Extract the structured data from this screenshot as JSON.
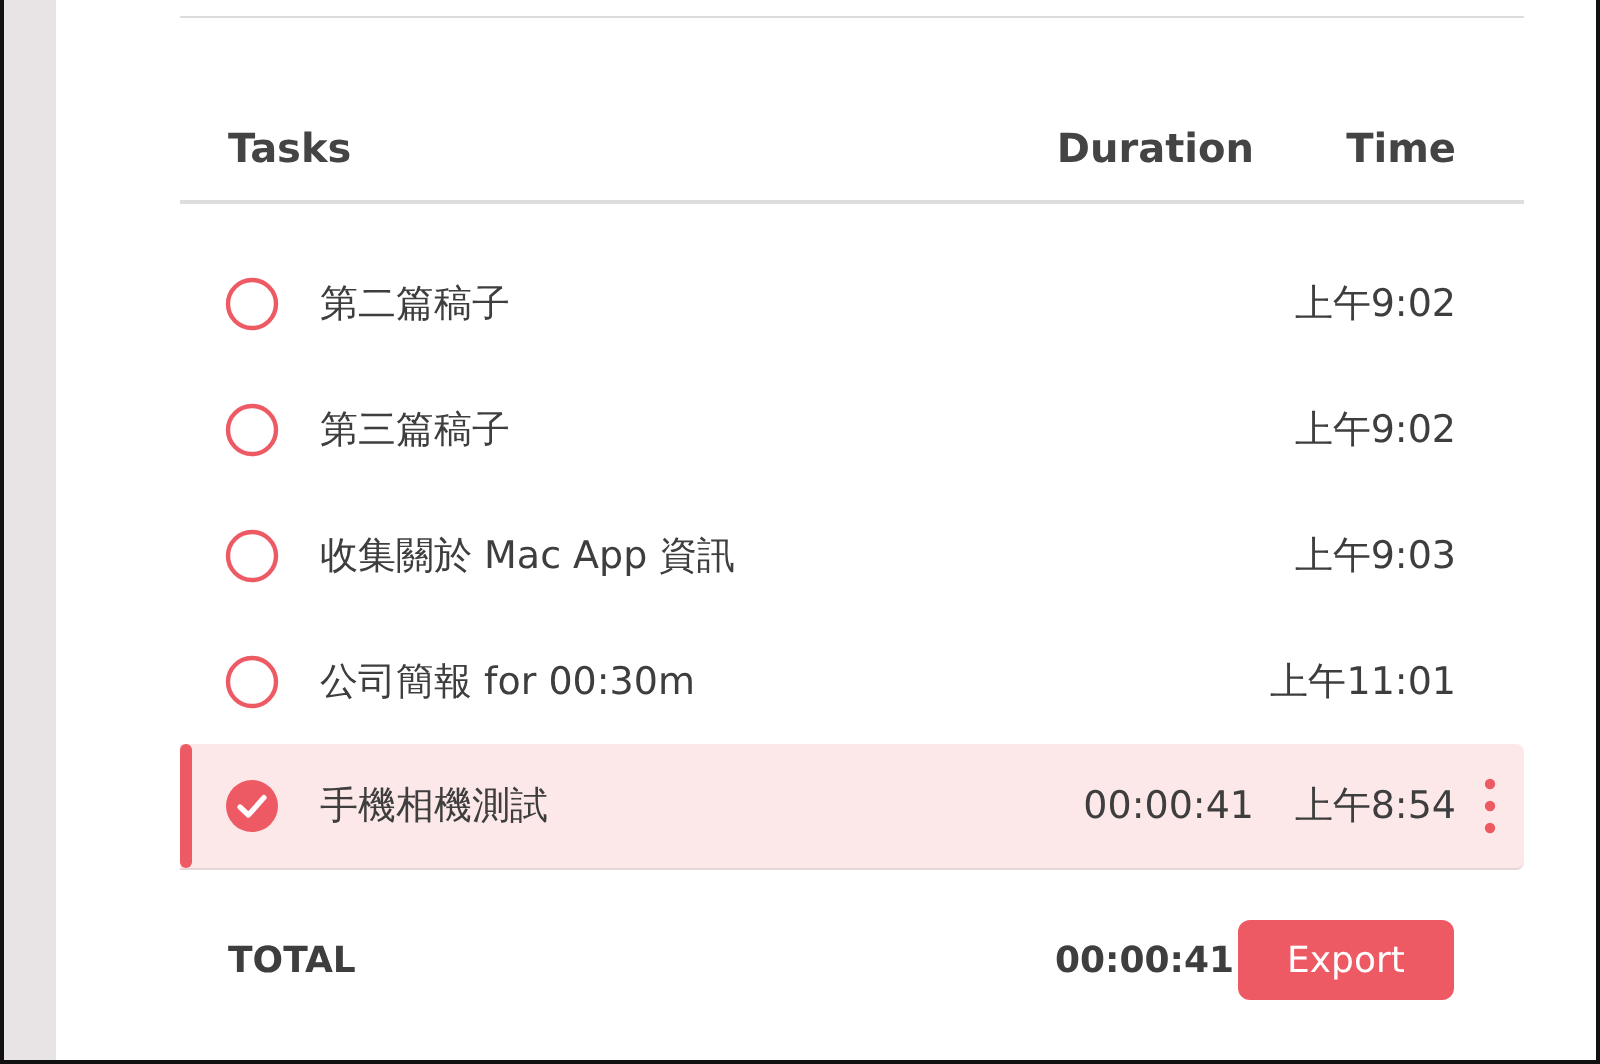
{
  "table": {
    "columns": [
      "Tasks",
      "Duration",
      "Time"
    ],
    "rows": [
      {
        "task": "第二篇稿子",
        "time": "上午9:02",
        "done": false,
        "selected": false
      },
      {
        "task": "第三篇稿子",
        "time": "上午9:02",
        "done": false,
        "selected": false
      },
      {
        "task": "收集關於 Mac App 資訊",
        "time": "上午9:03",
        "done": false,
        "selected": false
      },
      {
        "task": "公司簡報 for 00:30m",
        "time": "上午11:01",
        "done": false,
        "selected": false
      },
      {
        "task": "手機相機測試",
        "duration": "00:00:41",
        "time": "上午8:54",
        "done": true,
        "selected": true
      }
    ]
  },
  "total": {
    "label": "TOTAL",
    "duration": "00:00:41",
    "button": "Export"
  }
}
